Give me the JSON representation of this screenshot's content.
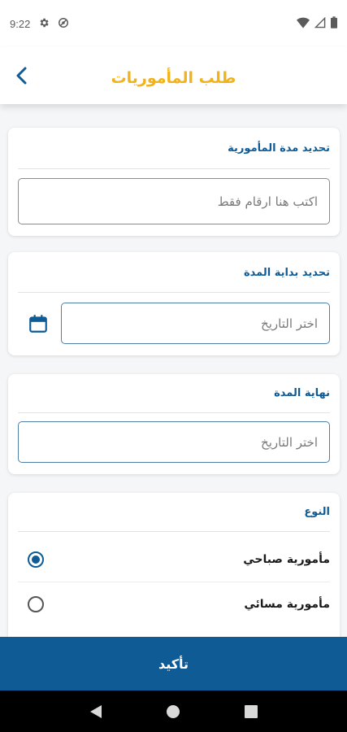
{
  "status_bar": {
    "time": "9:22",
    "icons": [
      "gear-icon",
      "sync-icon",
      "wifi-icon",
      "signal-icon",
      "battery-icon"
    ]
  },
  "header": {
    "title": "طلب المأموريات",
    "back_icon": "chevron-left-icon"
  },
  "duration": {
    "title": "تحديد مدة المأمورية",
    "placeholder": "اكتب هنا ارقام فقط"
  },
  "start_date": {
    "title": "تحديد بداية المدة",
    "placeholder": "اختر التاريخ",
    "icon": "calendar-icon"
  },
  "end_date": {
    "title": "نهاية المدة",
    "placeholder": "اختر التاريخ"
  },
  "type": {
    "title": "النوع",
    "options": [
      {
        "label": "مأمورية صباحي",
        "selected": true
      },
      {
        "label": "مأمورية مسائي",
        "selected": false
      }
    ]
  },
  "confirm_label": "تأكيد",
  "colors": {
    "primary": "#0f5b95",
    "title_accent": "#f2b21a",
    "background": "#f5f6f8"
  },
  "nav_bar": {
    "icons": [
      "back-triangle-icon",
      "home-circle-icon",
      "recents-square-icon"
    ]
  }
}
